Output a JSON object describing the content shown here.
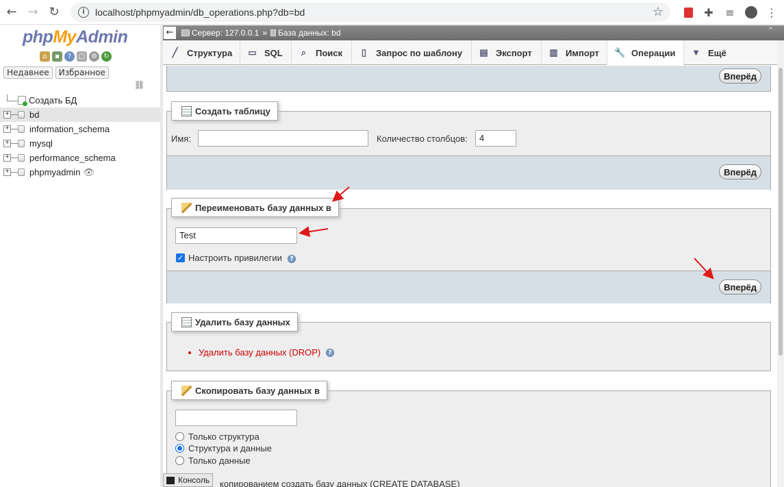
{
  "browser": {
    "url": "localhost/phpmyadmin/db_operations.php?db=bd"
  },
  "sidebar": {
    "logo_php": "php",
    "logo_my": "My",
    "logo_admin": "Admin",
    "tabs": [
      "Недавнее",
      "Избранное"
    ],
    "create_db": "Создать БД",
    "databases": [
      "bd",
      "information_schema",
      "mysql",
      "performance_schema",
      "phpmyadmin"
    ],
    "active_db": "bd"
  },
  "topbar": {
    "server": "Сервер: 127.0.0.1",
    "separator": "»",
    "database": "База данных: bd"
  },
  "tabs": [
    {
      "label": "Структура",
      "icon": "structure-icon"
    },
    {
      "label": "SQL",
      "icon": "sql-icon"
    },
    {
      "label": "Поиск",
      "icon": "search-icon"
    },
    {
      "label": "Запрос по шаблону",
      "icon": "query-icon"
    },
    {
      "label": "Экспорт",
      "icon": "export-icon"
    },
    {
      "label": "Импорт",
      "icon": "import-icon"
    },
    {
      "label": "Операции",
      "icon": "wrench-icon",
      "active": true
    },
    {
      "label": "Ещё",
      "icon": "chevron-down-icon"
    }
  ],
  "go_label": "Вперёд",
  "create_table": {
    "title": "Создать таблицу",
    "name_label": "Имя:",
    "name_value": "",
    "columns_label": "Количество столбцов:",
    "columns_value": "4"
  },
  "rename": {
    "title": "Переименовать базу данных в",
    "value": "Test",
    "privileges_label": "Настроить привилегии",
    "privileges_checked": true
  },
  "drop": {
    "title": "Удалить базу данных",
    "link": "Удалить базу данных (DROP)"
  },
  "copy": {
    "title": "Скопировать базу данных в",
    "value": "",
    "options": [
      "Только структура",
      "Структура и данные",
      "Только данные"
    ],
    "selected": "Структура и данные",
    "partial_text": "копированием создать базу данных (CREATE DATABASE)"
  },
  "console_label": "Консоль",
  "colors": {
    "accent_arrow": "#e0191b",
    "fieldset_bg": "#eeeeee",
    "footer_bg": "#d7dfe6",
    "link_red": "#cc0000"
  }
}
